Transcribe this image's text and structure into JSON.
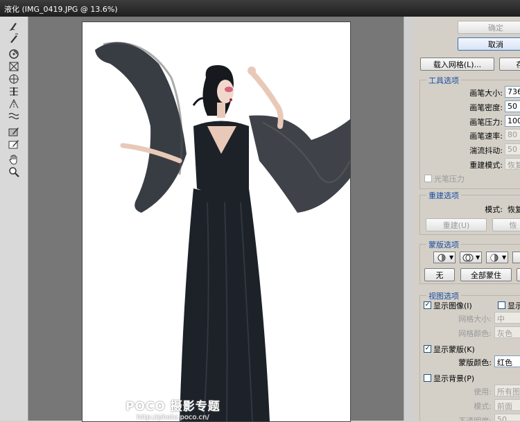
{
  "window": {
    "title": "液化 (IMG_0419.JPG @ 13.6%)"
  },
  "tools": [
    {
      "name": "forward-warp-tool-icon"
    },
    {
      "name": "reconstruct-tool-icon"
    },
    {
      "name": "twirl-clockwise-tool-icon"
    },
    {
      "name": "pucker-tool-icon"
    },
    {
      "name": "bloat-tool-icon"
    },
    {
      "name": "push-left-tool-icon"
    },
    {
      "name": "mirror-tool-icon"
    },
    {
      "name": "turbulence-tool-icon"
    },
    {
      "name": "freeze-mask-tool-icon"
    },
    {
      "name": "thaw-mask-tool-icon"
    },
    {
      "name": "hand-tool-icon"
    },
    {
      "name": "zoom-tool-icon"
    }
  ],
  "buttons": {
    "ok": "确定",
    "cancel": "取消",
    "load_mesh": "载入网格(L)...",
    "save_mesh": "存",
    "reconstruct": "重建(U)",
    "restore": "恢",
    "none": "无",
    "mask_all": "全部蒙住",
    "invert": ""
  },
  "tool_options": {
    "title": "工具选项",
    "brush_size": {
      "label": "画笔大小:",
      "value": "736"
    },
    "brush_density": {
      "label": "画笔密度:",
      "value": "50"
    },
    "brush_pressure": {
      "label": "画笔压力:",
      "value": "100"
    },
    "brush_rate": {
      "label": "画笔速率:",
      "value": "80"
    },
    "turbulent_jitter": {
      "label": "湍流抖动:",
      "value": "50"
    },
    "reconstruct_mode": {
      "label": "重建模式:",
      "value": "恢复"
    },
    "stylus_pressure": {
      "label": "光笔压力",
      "checked": false
    }
  },
  "reconstruct_options": {
    "title": "重建选项",
    "mode": {
      "label": "模式:",
      "value": "恢复"
    }
  },
  "mask_options": {
    "title": "蒙版选项"
  },
  "view_options": {
    "title": "视图选项",
    "show_image": {
      "label": "显示图像(I)",
      "checked": true
    },
    "show_mesh": {
      "label": "显示",
      "checked": false
    },
    "mesh_size": {
      "label": "网格大小:",
      "value": "中"
    },
    "mesh_color": {
      "label": "网格颜色:",
      "value": "灰色"
    },
    "show_mask": {
      "label": "显示蒙版(K)",
      "checked": true
    },
    "mask_color": {
      "label": "蒙版颜色:",
      "value": "红色"
    },
    "show_backdrop": {
      "label": "显示背景(P)",
      "checked": false
    },
    "use": {
      "label": "使用:",
      "value": "所有图层"
    },
    "mode": {
      "label": "模式:",
      "value": "前面"
    },
    "opacity": {
      "label": "不透明度:",
      "value": "50"
    }
  },
  "watermark": {
    "brand": "POCO 摄影专题",
    "url": "http://photo.poco.cn/"
  },
  "colors": {
    "section_title": "#1c4da1",
    "canvas_bg": "#777777",
    "panel_bg": "#d4d0c8",
    "dress": "#1d2229"
  }
}
